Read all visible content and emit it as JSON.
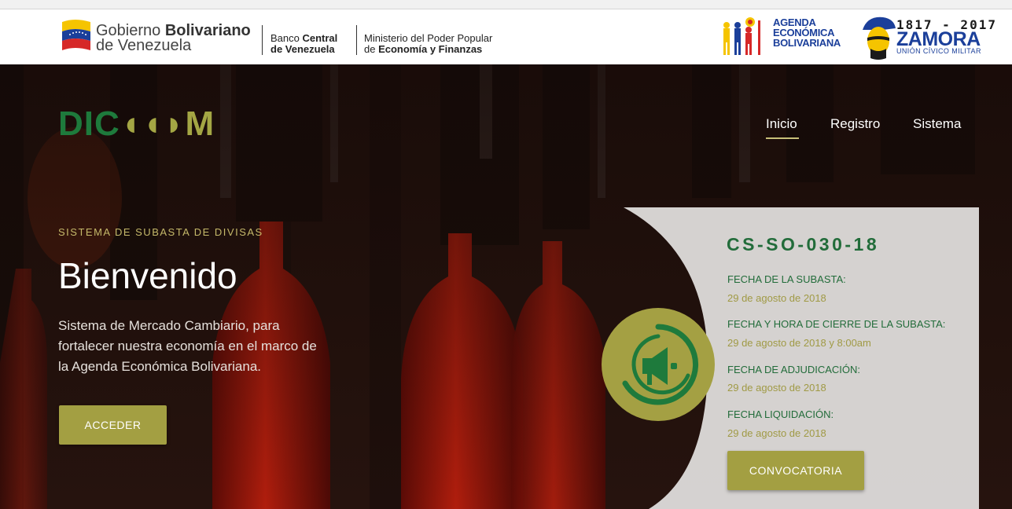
{
  "gov": {
    "name_light": "Gobierno ",
    "name_bold": "Bolivariano",
    "name_line2": "de Venezuela",
    "bcv_line1_light": "Banco ",
    "bcv_line1_bold": "Central",
    "bcv_line2": "de Venezuela",
    "min_line1": "Ministerio del Poder Popular",
    "min_line2_light": "de ",
    "min_line2_bold": "Economía y Finanzas",
    "aeb_line1": "AGENDA",
    "aeb_line2": "ECONÓMICA",
    "aeb_line3": "BOLIVARIANA",
    "zamora_years": "1817 - 2017",
    "zamora_name": "ZAMORA",
    "zamora_sub": "UNIÓN CÍVICO MILITAR"
  },
  "logo": {
    "part1": "DIC",
    "part2": "◖◖◗",
    "part3": "M"
  },
  "nav": {
    "items": [
      "Inicio",
      "Registro",
      "Sistema"
    ],
    "active": "Inicio"
  },
  "hero": {
    "eyebrow": "SISTEMA DE SUBASTA DE DIVISAS",
    "title": "Bienvenido",
    "description": "Sistema de Mercado Cambiario, para fortalecer nuestra economía en el marco de la Agenda Económica Bolivariana.",
    "cta_label": "ACCEDER"
  },
  "auction": {
    "code": "CS-SO-030-18",
    "fields": [
      {
        "label": "FECHA DE LA SUBASTA:",
        "value": "29 de agosto de 2018"
      },
      {
        "label": "FECHA Y HORA DE CIERRE DE LA SUBASTA:",
        "value": "29 de agosto de 2018 y 8:00am"
      },
      {
        "label": "FECHA DE ADJUDICACIÓN:",
        "value": "29 de agosto de 2018"
      },
      {
        "label": "FECHA LIQUIDACIÓN:",
        "value": "29 de agosto de 2018"
      }
    ],
    "button_label": "CONVOCATORIA",
    "icon": "megaphone-icon"
  },
  "colors": {
    "olive": "#a39f42",
    "green": "#226c3a",
    "panel": "#e3e1e0"
  }
}
